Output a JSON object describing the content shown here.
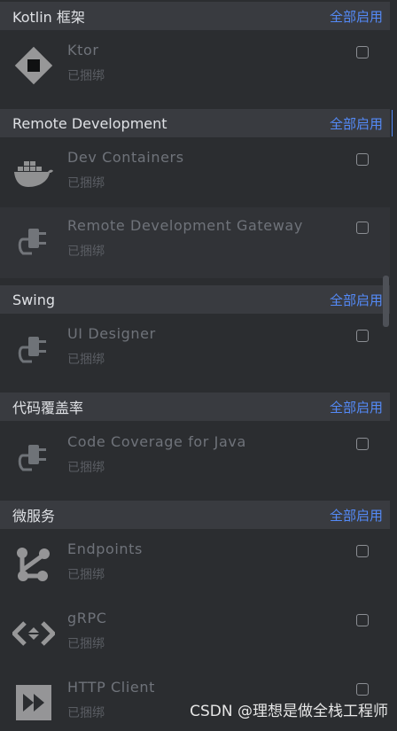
{
  "sections": [
    {
      "title": "Kotlin 框架",
      "enable_label": "全部启用"
    },
    {
      "title": "Remote Development",
      "enable_label": "全部启用"
    },
    {
      "title": "Swing",
      "enable_label": "全部启用"
    },
    {
      "title": "代码覆盖率",
      "enable_label": "全部启用"
    },
    {
      "title": "微服务",
      "enable_label": "全部启用"
    }
  ],
  "plugins": [
    {
      "name": "Ktor",
      "status": "已捆绑",
      "icon": "ktor-icon",
      "checked": false
    },
    {
      "name": "Dev Containers",
      "status": "已捆绑",
      "icon": "docker-icon",
      "checked": false
    },
    {
      "name": "Remote Development Gateway",
      "status": "已捆绑",
      "icon": "plug-icon",
      "checked": false
    },
    {
      "name": "UI Designer",
      "status": "已捆绑",
      "icon": "plug-icon",
      "checked": false
    },
    {
      "name": "Code Coverage for Java",
      "status": "已捆绑",
      "icon": "plug-icon",
      "checked": false
    },
    {
      "name": "Endpoints",
      "status": "已捆绑",
      "icon": "endpoints-icon",
      "checked": false
    },
    {
      "name": "gRPC",
      "status": "已捆绑",
      "icon": "grpc-icon",
      "checked": false
    },
    {
      "name": "HTTP Client",
      "status": "已捆绑",
      "icon": "http-client-icon",
      "checked": false
    }
  ],
  "watermark": "CSDN @理想是做全栈工程师",
  "colors": {
    "background": "#2b2d30",
    "section_header": "#393b40",
    "link": "#548af7",
    "disabled_text": "#6f737a"
  }
}
